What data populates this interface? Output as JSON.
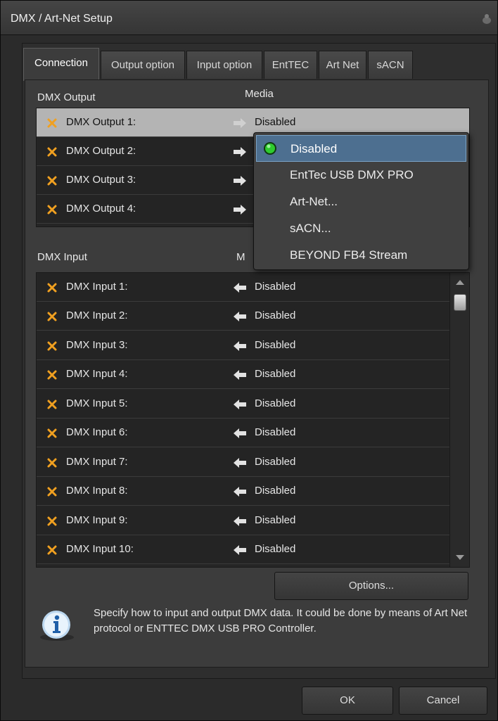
{
  "window": {
    "title": "DMX / Art-Net Setup"
  },
  "tabs": [
    {
      "label": "Connection"
    },
    {
      "label": "Output option"
    },
    {
      "label": "Input option"
    },
    {
      "label": "EntTEC"
    },
    {
      "label": "Art Net"
    },
    {
      "label": "sACN"
    }
  ],
  "active_tab": "Connection",
  "output_section": {
    "title": "DMX Output",
    "media_header": "Media",
    "rows": [
      {
        "label": "DMX Output 1:",
        "media": "Disabled",
        "selected": true
      },
      {
        "label": "DMX Output 2:",
        "media": ""
      },
      {
        "label": "DMX Output 3:",
        "media": ""
      },
      {
        "label": "DMX Output 4:",
        "media": ""
      }
    ]
  },
  "input_section": {
    "title": "DMX Input",
    "media_header": "M",
    "rows": [
      {
        "label": "DMX Input 1:",
        "media": "Disabled"
      },
      {
        "label": "DMX Input 2:",
        "media": "Disabled"
      },
      {
        "label": "DMX Input 3:",
        "media": "Disabled"
      },
      {
        "label": "DMX Input 4:",
        "media": "Disabled"
      },
      {
        "label": "DMX Input 5:",
        "media": "Disabled"
      },
      {
        "label": "DMX Input 6:",
        "media": "Disabled"
      },
      {
        "label": "DMX Input 7:",
        "media": "Disabled"
      },
      {
        "label": "DMX Input 8:",
        "media": "Disabled"
      },
      {
        "label": "DMX Input 9:",
        "media": "Disabled"
      },
      {
        "label": "DMX Input 10:",
        "media": "Disabled"
      }
    ]
  },
  "media_dropdown": {
    "selected": "Disabled",
    "options": [
      {
        "label": "Disabled"
      },
      {
        "label": "EntTec USB DMX PRO"
      },
      {
        "label": "Art-Net..."
      },
      {
        "label": "sACN..."
      },
      {
        "label": "BEYOND FB4 Stream"
      }
    ]
  },
  "options_button": {
    "label": "Options..."
  },
  "info": {
    "text": "Specify how to input and output DMX data. It could be done by means of Art Net protocol or ENTTEC DMX USB PRO Controller."
  },
  "footer": {
    "ok_label": "OK",
    "cancel_label": "Cancel"
  },
  "colors": {
    "accent_selected": "#4d6f90",
    "x_icon": "#f0a020",
    "led_green": "#2ecc2e"
  },
  "icons": {
    "row_status": "x-icon",
    "output_arrow": "arrow-right-icon",
    "input_arrow": "arrow-left-icon",
    "info": "info-icon"
  }
}
